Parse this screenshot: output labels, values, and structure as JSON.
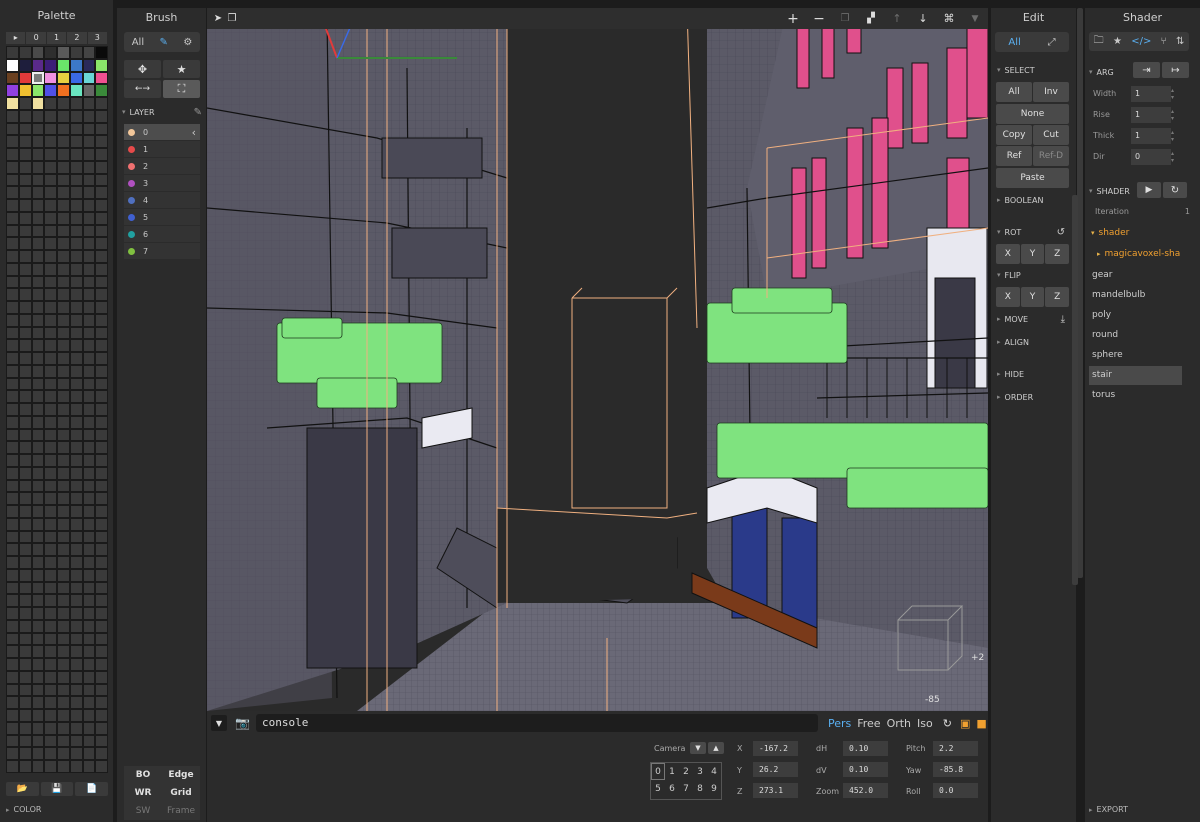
{
  "palette": {
    "title": "Palette",
    "tabs": [
      "▸",
      "0",
      "1",
      "2",
      "3"
    ],
    "rows": [
      [
        "#3a3a3a",
        "#3a3a3a",
        "#4a4a4a",
        "#2e2e2e",
        "#5a5a5a",
        "#3c3c3c",
        "#444444",
        "#0a0a0a"
      ],
      [
        "#ffffff",
        "#1e1e3c",
        "#5a2a8a",
        "#3c1e78",
        "#6ae56a",
        "#3c78c8",
        "#2a2a5a",
        "#8ae56a"
      ],
      [
        "#6a4020",
        "#e23a3a",
        "#7a7a7a",
        "#f090e0",
        "#e6d040",
        "#3a6ae6",
        "#6ad6d6",
        "#f05090"
      ],
      [
        "#9040e0",
        "#f0c030",
        "#8ae56a",
        "#5050e6",
        "#f07020",
        "#6ae5c0",
        "#666666",
        "#3a8a3a"
      ],
      [
        "#f0e0a0",
        "#3a3a3a",
        "#f0e0a0",
        "#3a3a3a",
        "#3a3a3a",
        "#3a3a3a",
        "#3a3a3a",
        "#3a3a3a"
      ]
    ],
    "selected_row": 2,
    "selected_col": 2,
    "empty_color": "#3a3a3a",
    "footer_icons": [
      "folder-open-icon",
      "save-icon",
      "file-icon"
    ],
    "color_label": "COLOR"
  },
  "brush": {
    "title": "Brush",
    "mode_label": "All",
    "layer_label": "LAYER",
    "layers": [
      {
        "name": "0",
        "color": "#f2c79a"
      },
      {
        "name": "1",
        "color": "#e64a4a"
      },
      {
        "name": "2",
        "color": "#f07070"
      },
      {
        "name": "3",
        "color": "#b050c0"
      },
      {
        "name": "4",
        "color": "#5070c0"
      },
      {
        "name": "5",
        "color": "#4060d0"
      },
      {
        "name": "6",
        "color": "#20a0a0"
      },
      {
        "name": "7",
        "color": "#80c040"
      }
    ],
    "toggles": {
      "bo": "BO",
      "edge": "Edge",
      "wr": "WR",
      "grid": "Grid",
      "sw": "SW",
      "frame": "Frame"
    }
  },
  "viewport": {
    "overlay_plus2": "+2",
    "overlay_minus85": "-85",
    "scene_colors": {
      "sky": "#262626",
      "wall": "#5c5b68",
      "grid_line": "#3d3c48",
      "edge": "#111111",
      "foliage": "#7fe37f",
      "magenta": "#e0508c",
      "guide": "#f0b080",
      "blue_door": "#2a3a8a",
      "wood": "#7a3a1a"
    }
  },
  "console": {
    "placeholder": "console",
    "modes": [
      "Pers",
      "Free",
      "Orth",
      "Iso"
    ],
    "active_mode": "Pers"
  },
  "camera": {
    "label": "Camera",
    "nums_top": [
      "0",
      "1",
      "2",
      "3",
      "4"
    ],
    "nums_bottom": [
      "5",
      "6",
      "7",
      "8",
      "9"
    ],
    "fields": {
      "x_label": "X",
      "x": "-167.2",
      "y_label": "Y",
      "y": "26.2",
      "z_label": "Z",
      "z": "273.1",
      "dh_label": "dH",
      "dh": "0.10",
      "dv_label": "dV",
      "dv": "0.10",
      "zoom_label": "Zoom",
      "zoom": "452.0",
      "pitch_label": "Pitch",
      "pitch": "2.2",
      "yaw_label": "Yaw",
      "yaw": "-85.8",
      "roll_label": "Roll",
      "roll": "0.0"
    }
  },
  "edit": {
    "title": "Edit",
    "mode_label": "All",
    "select": "SELECT",
    "all": "All",
    "inv": "Inv",
    "none": "None",
    "copy": "Copy",
    "cut": "Cut",
    "ref": "Ref",
    "refd": "Ref-D",
    "paste": "Paste",
    "boolean": "BOOLEAN",
    "rot": "ROT",
    "flip": "FLIP",
    "x": "X",
    "y": "Y",
    "z": "Z",
    "move": "MOVE",
    "align": "ALIGN",
    "hide": "HIDE",
    "order": "ORDER"
  },
  "shader": {
    "title": "Shader",
    "arg": "ARG",
    "args": [
      {
        "label": "Width",
        "value": "1"
      },
      {
        "label": "Rise",
        "value": "1"
      },
      {
        "label": "Thick",
        "value": "1"
      },
      {
        "label": "Dir",
        "value": "0"
      }
    ],
    "shader_label": "SHADER",
    "iteration_label": "Iteration",
    "iteration_value": "1",
    "tree_root": "shader",
    "tree_child": "magicavoxel-sha",
    "items": [
      "gear",
      "mandelbulb",
      "poly",
      "round",
      "sphere",
      "stair",
      "torus"
    ],
    "selected_item": "stair",
    "export": "EXPORT"
  }
}
